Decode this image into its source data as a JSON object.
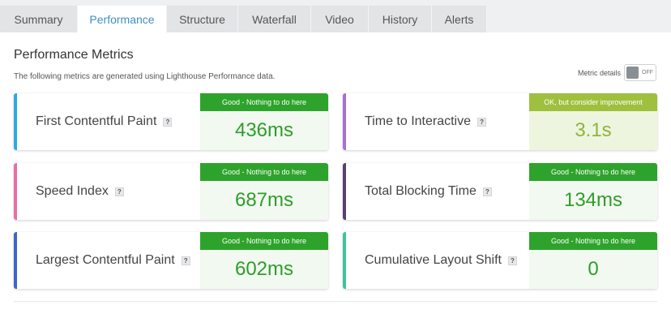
{
  "tabs": [
    {
      "label": "Summary"
    },
    {
      "label": "Performance"
    },
    {
      "label": "Structure"
    },
    {
      "label": "Waterfall"
    },
    {
      "label": "Video"
    },
    {
      "label": "History"
    },
    {
      "label": "Alerts"
    }
  ],
  "active_tab": "Performance",
  "header": {
    "title": "Performance Metrics",
    "subtitle": "The following metrics are generated using Lighthouse Performance data.",
    "metric_details_label": "Metric details",
    "toggle_state": "OFF"
  },
  "help_glyph": "?",
  "metrics": [
    {
      "label": "First Contentful Paint",
      "grade": "Good - Nothing to do here",
      "value": "436ms",
      "accent": "#2fa9e0"
    },
    {
      "label": "Time to Interactive",
      "grade": "OK, but consider improvement",
      "value": "3.1s",
      "accent": "#a970cf"
    },
    {
      "label": "Speed Index",
      "grade": "Good - Nothing to do here",
      "value": "687ms",
      "accent": "#e86ea4"
    },
    {
      "label": "Total Blocking Time",
      "grade": "Good - Nothing to do here",
      "value": "134ms",
      "accent": "#5b3f6e"
    },
    {
      "label": "Largest Contentful Paint",
      "grade": "Good - Nothing to do here",
      "value": "602ms",
      "accent": "#3b67c8"
    },
    {
      "label": "Cumulative Layout Shift",
      "grade": "Good - Nothing to do here",
      "value": "0",
      "accent": "#3fc39a"
    }
  ],
  "colors": {
    "good": "#2ea32b",
    "ok": "#9ec03e",
    "active_tab_text": "#3d8fc6"
  }
}
